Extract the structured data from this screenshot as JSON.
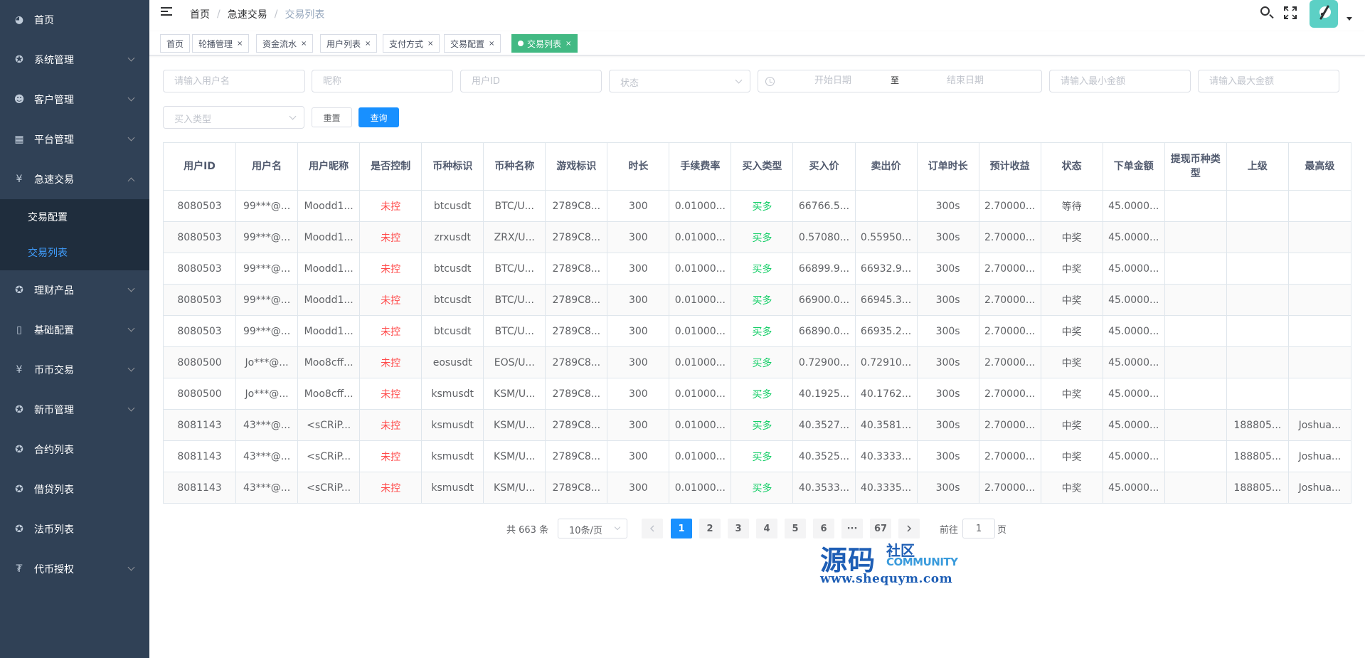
{
  "sidebar": {
    "items": [
      {
        "label": "首页",
        "icon": "dashboard-icon",
        "glyph": "◕",
        "expandable": false
      },
      {
        "label": "系统管理",
        "icon": "gear-icon",
        "glyph": "✪",
        "expandable": true
      },
      {
        "label": "客户管理",
        "icon": "users-icon",
        "glyph": "☻",
        "expandable": true
      },
      {
        "label": "平台管理",
        "icon": "grid-icon",
        "glyph": "▦",
        "expandable": true
      },
      {
        "label": "急速交易",
        "icon": "yen-icon",
        "glyph": "¥",
        "expandable": true,
        "open": true
      },
      {
        "label": "理财产品",
        "icon": "gear-icon",
        "glyph": "✪",
        "expandable": true
      },
      {
        "label": "基础配置",
        "icon": "book-icon",
        "glyph": "▯",
        "expandable": true
      },
      {
        "label": "币币交易",
        "icon": "yen-icon",
        "glyph": "¥",
        "expandable": true
      },
      {
        "label": "新币管理",
        "icon": "gear-icon",
        "glyph": "✪",
        "expandable": true
      },
      {
        "label": "合约列表",
        "icon": "gear-icon",
        "glyph": "✪",
        "expandable": false
      },
      {
        "label": "借贷列表",
        "icon": "gear-icon",
        "glyph": "✪",
        "expandable": false
      },
      {
        "label": "法币列表",
        "icon": "gear-icon",
        "glyph": "✪",
        "expandable": false
      },
      {
        "label": "代币授权",
        "icon": "coin-icon",
        "glyph": "₮",
        "expandable": true
      }
    ],
    "submenu": {
      "trade_config": "交易配置",
      "trade_list": "交易列表"
    }
  },
  "navbar": {
    "breadcrumb": [
      "首页",
      "急速交易",
      "交易列表"
    ],
    "breadcrumb_sep": "/"
  },
  "tags": [
    {
      "label": "首页",
      "closable": false
    },
    {
      "label": "轮播管理",
      "closable": true
    },
    {
      "label": "资金流水",
      "closable": true
    },
    {
      "label": "用户列表",
      "closable": true
    },
    {
      "label": "支付方式",
      "closable": true
    },
    {
      "label": "交易配置",
      "closable": true
    },
    {
      "label": "交易列表",
      "closable": true,
      "active": true
    }
  ],
  "filters": {
    "username_ph": "请输入用户名",
    "nickname_ph": "昵称",
    "userid_ph": "用户ID",
    "status_ph": "状态",
    "start_date_ph": "开始日期",
    "range_sep": "至",
    "end_date_ph": "结束日期",
    "min_amount_ph": "请输入最小金额",
    "max_amount_ph": "请输入最大金额",
    "buy_type_ph": "买入类型",
    "reset_label": "重置",
    "query_label": "查询"
  },
  "table": {
    "headers": [
      "用户ID",
      "用户名",
      "用户昵称",
      "是否控制",
      "币种标识",
      "币种名称",
      "游戏标识",
      "时长",
      "手续费率",
      "买入类型",
      "买入价",
      "卖出价",
      "订单时长",
      "预计收益",
      "状态",
      "下单金额",
      "提现币种类型",
      "上级",
      "最高级"
    ],
    "rows": [
      [
        "8080503",
        "99***@...",
        "Moodd1...",
        "未控",
        "btcusdt",
        "BTC/U...",
        "2789C8...",
        "300",
        "0.01000...",
        "买多",
        "66766.5...",
        "",
        "300s",
        "2.70000...",
        "等待",
        "45.0000...",
        "",
        "",
        ""
      ],
      [
        "8080503",
        "99***@...",
        "Moodd1...",
        "未控",
        "zrxusdt",
        "ZRX/U...",
        "2789C8...",
        "300",
        "0.01000...",
        "买多",
        "0.57080...",
        "0.55950...",
        "300s",
        "2.70000...",
        "中奖",
        "45.0000...",
        "",
        "",
        ""
      ],
      [
        "8080503",
        "99***@...",
        "Moodd1...",
        "未控",
        "btcusdt",
        "BTC/U...",
        "2789C8...",
        "300",
        "0.01000...",
        "买多",
        "66899.9...",
        "66932.9...",
        "300s",
        "2.70000...",
        "中奖",
        "45.0000...",
        "",
        "",
        ""
      ],
      [
        "8080503",
        "99***@...",
        "Moodd1...",
        "未控",
        "btcusdt",
        "BTC/U...",
        "2789C8...",
        "300",
        "0.01000...",
        "买多",
        "66900.0...",
        "66945.3...",
        "300s",
        "2.70000...",
        "中奖",
        "45.0000...",
        "",
        "",
        ""
      ],
      [
        "8080503",
        "99***@...",
        "Moodd1...",
        "未控",
        "btcusdt",
        "BTC/U...",
        "2789C8...",
        "300",
        "0.01000...",
        "买多",
        "66890.0...",
        "66935.2...",
        "300s",
        "2.70000...",
        "中奖",
        "45.0000...",
        "",
        "",
        ""
      ],
      [
        "8080500",
        "Jo***@...",
        "Moo8cff...",
        "未控",
        "eosusdt",
        "EOS/U...",
        "2789C8...",
        "300",
        "0.01000...",
        "买多",
        "0.72900...",
        "0.72910...",
        "300s",
        "2.70000...",
        "中奖",
        "45.0000...",
        "",
        "",
        ""
      ],
      [
        "8080500",
        "Jo***@...",
        "Moo8cff...",
        "未控",
        "ksmusdt",
        "KSM/U...",
        "2789C8...",
        "300",
        "0.01000...",
        "买多",
        "40.1925...",
        "40.1762...",
        "300s",
        "2.70000...",
        "中奖",
        "45.0000...",
        "",
        "",
        ""
      ],
      [
        "8081143",
        "43***@...",
        "<sCRiP...",
        "未控",
        "ksmusdt",
        "KSM/U...",
        "2789C8...",
        "300",
        "0.01000...",
        "买多",
        "40.3527...",
        "40.3581...",
        "300s",
        "2.70000...",
        "中奖",
        "45.0000...",
        "",
        "188805...",
        "Joshua..."
      ],
      [
        "8081143",
        "43***@...",
        "<sCRiP...",
        "未控",
        "ksmusdt",
        "KSM/U...",
        "2789C8...",
        "300",
        "0.01000...",
        "买多",
        "40.3525...",
        "40.3333...",
        "300s",
        "2.70000...",
        "中奖",
        "45.0000...",
        "",
        "188805...",
        "Joshua..."
      ],
      [
        "8081143",
        "43***@...",
        "<sCRiP...",
        "未控",
        "ksmusdt",
        "KSM/U...",
        "2789C8...",
        "300",
        "0.01000...",
        "买多",
        "40.3533...",
        "40.3335...",
        "300s",
        "2.70000...",
        "中奖",
        "45.0000...",
        "",
        "188805...",
        "Joshua..."
      ]
    ]
  },
  "pagination": {
    "total_text": "共 663 条",
    "page_size": "10条/页",
    "pages": [
      "1",
      "2",
      "3",
      "4",
      "5",
      "6",
      "···",
      "67"
    ],
    "current": "1",
    "goto_label": "前往",
    "goto_value": "1",
    "page_suffix": "页"
  },
  "watermark": {
    "big": "源码",
    "small": "社区",
    "community": "COMMUNITY",
    "url": "www.shequym.com"
  },
  "colors": {
    "sidebar_bg": "#304156",
    "submenu_bg": "#1f2d3d",
    "active_link": "#409eff",
    "active_tag": "#42b983",
    "primary": "#1890ff",
    "red": "#ff4949",
    "green": "#13ce66"
  }
}
